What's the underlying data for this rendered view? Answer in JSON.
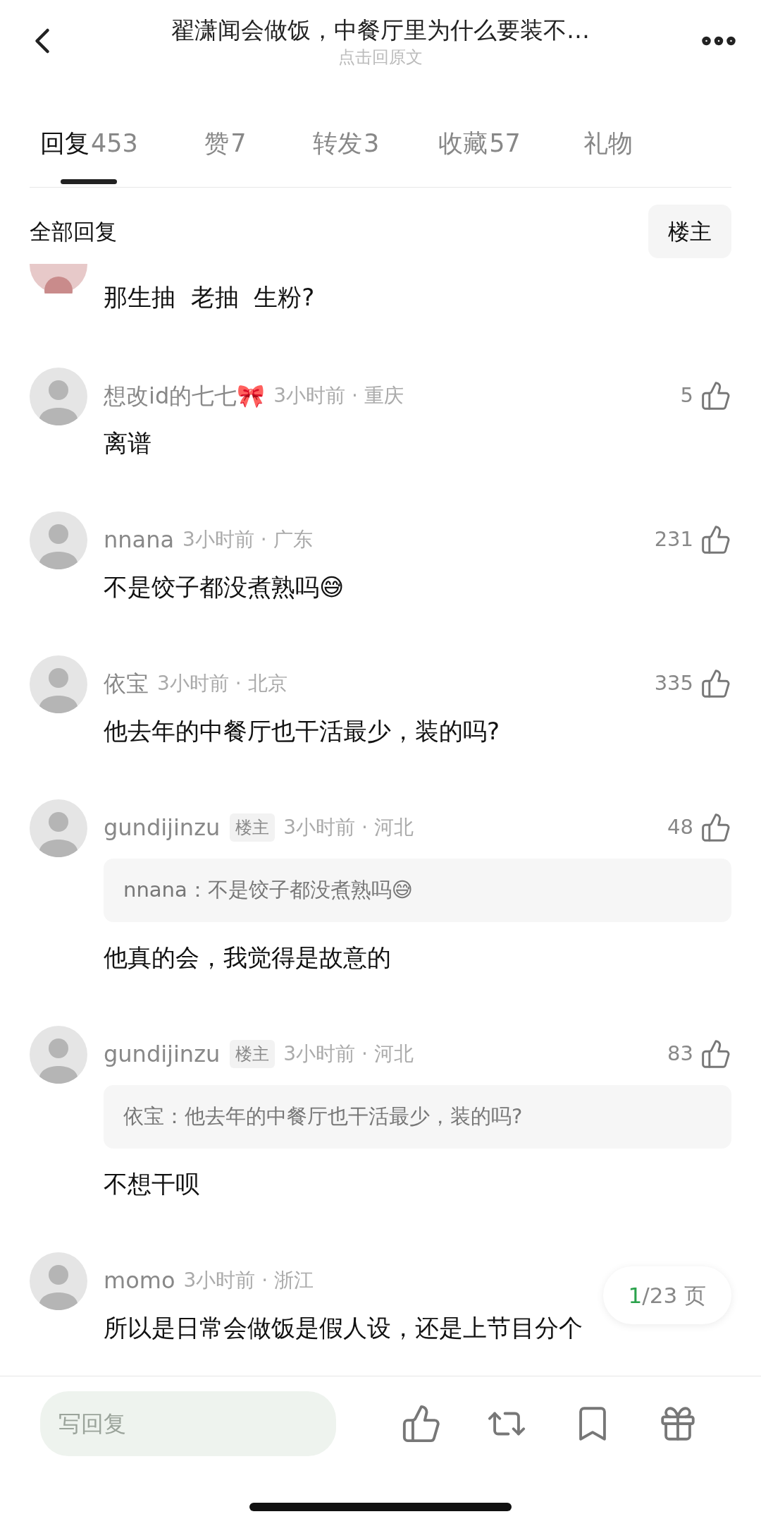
{
  "header": {
    "title": "翟潇闻会做饭，中餐厅里为什么要装不…",
    "subtitle": "点击回原文"
  },
  "tabs": [
    {
      "label": "回复",
      "count": "453",
      "selected": true
    },
    {
      "label": "赞",
      "count": "7",
      "selected": false
    },
    {
      "label": "转发",
      "count": "3",
      "selected": false
    },
    {
      "label": "收藏",
      "count": "57",
      "selected": false
    },
    {
      "label": "礼物",
      "selected": false
    }
  ],
  "filter": {
    "label": "全部回复",
    "button": "楼主"
  },
  "comments": [
    {
      "kind": "partial",
      "content": "那生抽  老抽  生粉?"
    },
    {
      "kind": "full",
      "name": "想改id的七七🎀",
      "meta": "3小时前 · 重庆",
      "likes": "5",
      "content": "离谱"
    },
    {
      "kind": "full",
      "name": "nnana",
      "meta": "3小时前 · 广东",
      "likes": "231",
      "content": "不是饺子都没煮熟吗😅"
    },
    {
      "kind": "full",
      "name": "依宝",
      "meta": "3小时前 · 北京",
      "likes": "335",
      "content": "他去年的中餐厅也干活最少，装的吗?"
    },
    {
      "kind": "full",
      "name": "gundijinzu",
      "badge": "楼主",
      "meta": "3小时前 · 河北",
      "likes": "48",
      "quote": "nnana：不是饺子都没煮熟吗😅",
      "content": "他真的会，我觉得是故意的"
    },
    {
      "kind": "full",
      "name": "gundijinzu",
      "badge": "楼主",
      "meta": "3小时前 · 河北",
      "likes": "83",
      "quote": "依宝：他去年的中餐厅也干活最少，装的吗?",
      "content": "不想干呗"
    },
    {
      "kind": "full",
      "name": "momo",
      "meta": "3小时前 · 浙江",
      "content": "所以是日常会做饭是假人设，还是上节目分个"
    }
  ],
  "pager": {
    "current": "1",
    "total": "/23 页"
  },
  "reply_bar": {
    "placeholder": "写回复"
  }
}
